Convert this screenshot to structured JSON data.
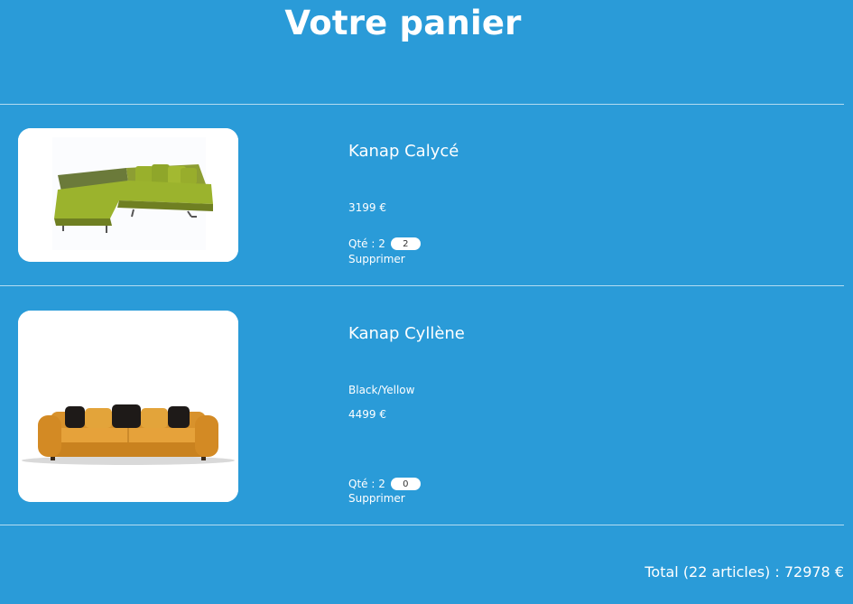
{
  "page": {
    "title": "Votre panier"
  },
  "cart": {
    "items": [
      {
        "name": "Kanap Calycé",
        "color": "",
        "price": "3199 €",
        "qty_label": "Qté : 2",
        "qty_value": "2",
        "delete_label": "Supprimer",
        "image_icon": "green-sectional-sofa-image"
      },
      {
        "name": "Kanap Cyllène",
        "color": "Black/Yellow",
        "price": "4499 €",
        "qty_label": "Qté : 2",
        "qty_value": "0",
        "delete_label": "Supprimer",
        "image_icon": "yellow-sofa-image"
      }
    ],
    "total_text": "Total (22 articles) : 72978 €"
  },
  "colors": {
    "background": "#2a9bd8",
    "text": "#ffffff"
  }
}
